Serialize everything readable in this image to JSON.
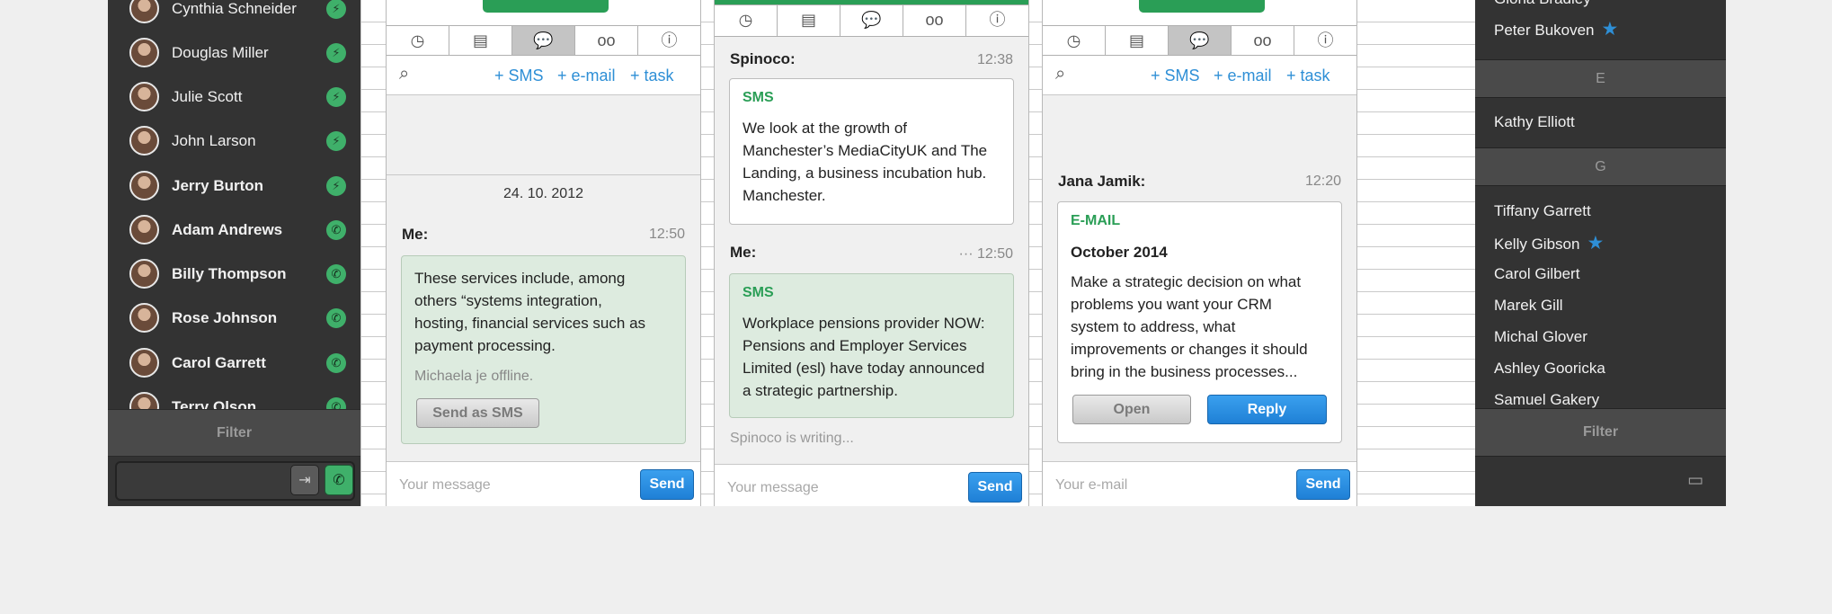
{
  "contacts": [
    {
      "name": "Cynthia Schneider",
      "bold": false,
      "status": "⚡"
    },
    {
      "name": "Douglas Miller",
      "bold": false,
      "status": "⚡"
    },
    {
      "name": "Julie Scott",
      "bold": false,
      "status": "⚡"
    },
    {
      "name": "John Larson",
      "bold": false,
      "status": "⚡"
    },
    {
      "name": "Jerry Burton",
      "bold": true,
      "status": "⚡"
    },
    {
      "name": "Adam Andrews",
      "bold": true,
      "status": "✆"
    },
    {
      "name": "Billy Thompson",
      "bold": true,
      "status": "✆"
    },
    {
      "name": "Rose Johnson",
      "bold": true,
      "status": "✆"
    },
    {
      "name": "Carol Garrett",
      "bold": true,
      "status": "✆"
    },
    {
      "name": "Terry Olson",
      "bold": true,
      "status": "✆"
    }
  ],
  "left_filter": "Filter",
  "actions": {
    "sms": "+ SMS",
    "email": "+ e-mail",
    "task": "+ task"
  },
  "tab_icons": [
    "clock-icon",
    "note-icon",
    "chat-icon",
    "voicemail-icon",
    "info-icon"
  ],
  "card1": {
    "date": "24. 10. 2012",
    "sender": "Me:",
    "time": "12:50",
    "text_lines": [
      "These services include, among",
      "others “systems integration,",
      "hosting, financial services such as",
      "payment processing."
    ],
    "offline": "Michaela je offline.",
    "send_as_sms": "Send as SMS",
    "placeholder": "Your message",
    "send": "Send"
  },
  "card2": {
    "msg1": {
      "sender": "Spinoco:",
      "time": "12:38",
      "type": "SMS",
      "text_lines": [
        "We look at the growth of",
        "Manchester’s MediaCityUK and The",
        "Landing, a business incubation hub.",
        "Manchester."
      ]
    },
    "msg2": {
      "sender": "Me:",
      "time": "··· 12:50",
      "type": "SMS",
      "text_lines": [
        "Workplace pensions provider NOW:",
        "Pensions and Employer Services",
        "Limited (esl) have today announced",
        "a strategic partnership."
      ]
    },
    "writing": "Spinoco is writing...",
    "placeholder": "Your message",
    "send": "Send"
  },
  "card3": {
    "sender": "Jana Jamik:",
    "time": "12:20",
    "type": "E-MAIL",
    "title": "October 2014",
    "text_lines": [
      "Make a strategic decision on what",
      "problems you want your CRM",
      "system to address, what",
      "improvements or changes it should",
      "bring in the business processes..."
    ],
    "open": "Open",
    "reply": "Reply",
    "placeholder": "Your e-mail",
    "send": "Send"
  },
  "phonebook": {
    "top_partial": "Gloria Bradley",
    "top": [
      {
        "name": "Peter Bukoven",
        "star": true
      }
    ],
    "section_e": "E",
    "e_items": [
      {
        "name": "Kathy Elliott",
        "star": false
      }
    ],
    "section_g": "G",
    "g_items": [
      {
        "name": "Tiffany Garrett",
        "star": false
      },
      {
        "name": "Kelly Gibson",
        "star": true
      },
      {
        "name": "Carol Gilbert",
        "star": false
      },
      {
        "name": "Marek Gill",
        "star": false
      },
      {
        "name": "Michal Glover",
        "star": false
      },
      {
        "name": "Ashley Gooricka",
        "star": false
      },
      {
        "name": "Samuel Gakery",
        "star": false
      }
    ],
    "filter": "Filter"
  },
  "colors": {
    "green": "#2a9e56",
    "blue": "#2e8fd6",
    "dark": "#333333"
  }
}
